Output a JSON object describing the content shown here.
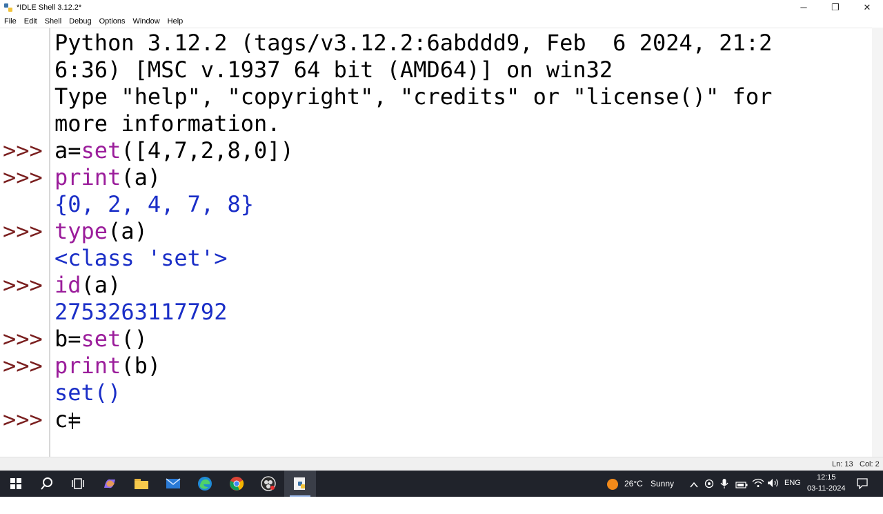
{
  "window": {
    "title": "*IDLE Shell 3.12.2*",
    "controls": {
      "minimize": "─",
      "restore": "❐",
      "close": "✕"
    }
  },
  "menu": {
    "items": [
      "File",
      "Edit",
      "Shell",
      "Debug",
      "Options",
      "Window",
      "Help"
    ]
  },
  "shell": {
    "banner": [
      "Python 3.12.2 (tags/v3.12.2:6abddd9, Feb  6 2024, 21:2",
      "6:36) [MSC v.1937 64 bit (AMD64)] on win32",
      "Type \"help\", \"copyright\", \"credits\" or \"license()\" for",
      "more information."
    ],
    "prompt": ">>>",
    "lines": [
      {
        "in": {
          "pre": "a=",
          "kw": "set",
          "post": "([4,7,2,8,0])"
        }
      },
      {
        "in": {
          "pre": "",
          "kw": "print",
          "post": "(a)"
        }
      },
      {
        "out": "{0, 2, 4, 7, 8}"
      },
      {
        "in": {
          "pre": "",
          "kw": "type",
          "post": "(a)"
        }
      },
      {
        "out": "<class 'set'>"
      },
      {
        "in": {
          "pre": "",
          "kw": "id",
          "post": "(a)"
        }
      },
      {
        "out": "2753263117792"
      },
      {
        "in": {
          "pre": "b=",
          "kw": "set",
          "post": "()"
        }
      },
      {
        "in": {
          "pre": "",
          "kw": "print",
          "post": "(b)"
        }
      },
      {
        "out": "set()"
      },
      {
        "in": {
          "pre": "c=",
          "kw": "",
          "post": ""
        }
      }
    ]
  },
  "status": {
    "line": "Ln: 13",
    "col": "Col: 2"
  },
  "taskbar": {
    "weather": {
      "temp": "26°C",
      "condition": "Sunny"
    },
    "language": "ENG",
    "time": "12:15",
    "date": "03-11-2024",
    "icons": [
      "windows-start-icon",
      "search-icon",
      "task-view-icon",
      "copilot-icon",
      "file-explorer-icon",
      "mail-icon",
      "edge-icon",
      "chrome-icon",
      "obs-icon",
      "idle-python-icon"
    ]
  },
  "colors": {
    "prompt": "#7a1f1f",
    "keyword": "#9b1d9b",
    "output": "#1a2ec7",
    "taskbar": "#20232b"
  }
}
